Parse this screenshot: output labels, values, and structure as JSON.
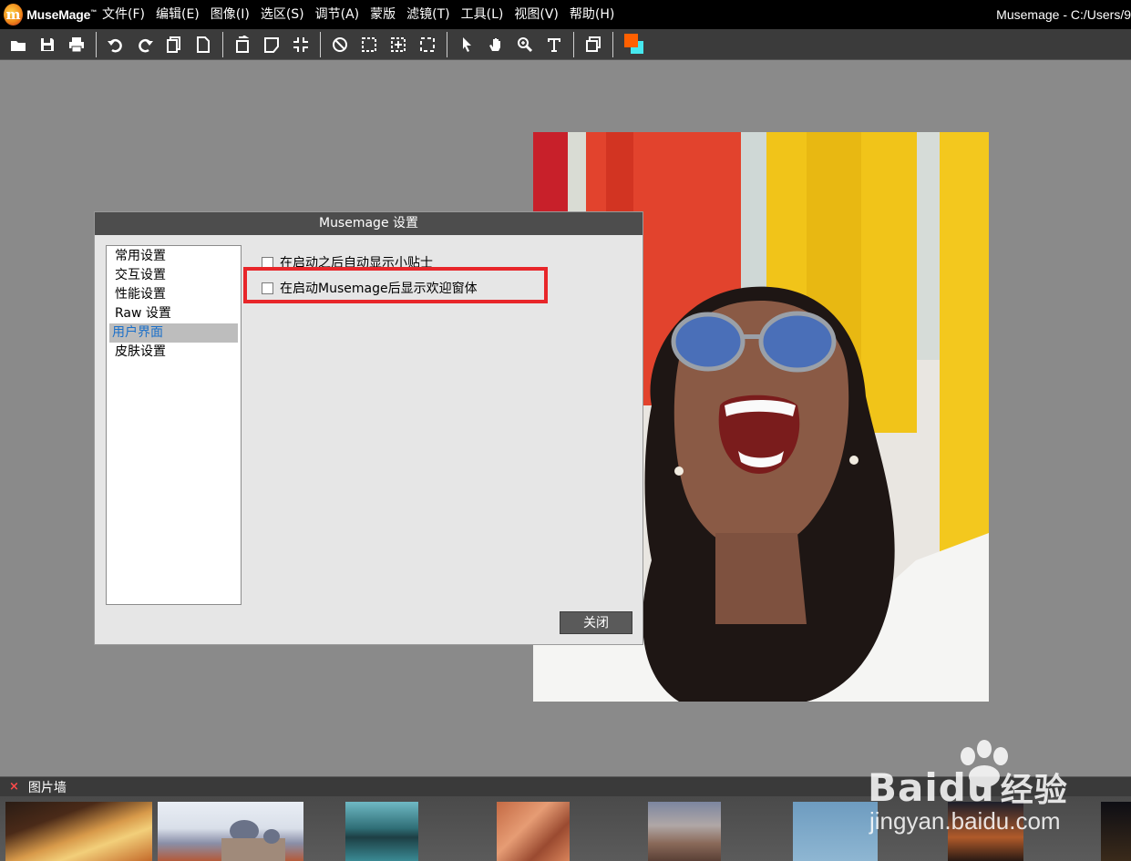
{
  "app": {
    "logo_letter": "m",
    "logo_name": "MuseMage",
    "logo_tm": "™",
    "window_title": "Musemage - C:/Users/9"
  },
  "menu": [
    {
      "label": "文件(F)"
    },
    {
      "label": "编辑(E)"
    },
    {
      "label": "图像(I)"
    },
    {
      "label": "选区(S)"
    },
    {
      "label": "调节(A)"
    },
    {
      "label": "蒙版"
    },
    {
      "label": "滤镜(T)"
    },
    {
      "label": "工具(L)"
    },
    {
      "label": "视图(V)"
    },
    {
      "label": "帮助(H)"
    }
  ],
  "toolbar": {
    "groups": [
      [
        "open-folder-icon",
        "save-icon",
        "print-icon"
      ],
      [
        "undo-icon",
        "redo-icon",
        "copy-icon",
        "new-document-icon"
      ],
      [
        "rotate-icon",
        "flip-icon",
        "fit-screen-icon"
      ],
      [
        "deselect-icon",
        "marquee-select-icon",
        "move-selection-icon",
        "crop-select-icon"
      ],
      [
        "pointer-icon",
        "hand-icon",
        "zoom-icon",
        "text-icon"
      ],
      [
        "layers-icon"
      ]
    ],
    "foreground_color": "#ff6000",
    "background_color": "#46e8ee"
  },
  "dialog": {
    "title": "Musemage 设置",
    "categories": [
      {
        "label": "常用设置",
        "selected": false
      },
      {
        "label": "交互设置",
        "selected": false
      },
      {
        "label": "性能设置",
        "selected": false
      },
      {
        "label": "Raw 设置",
        "selected": false
      },
      {
        "label": "用户界面",
        "selected": true
      },
      {
        "label": "皮肤设置",
        "selected": false
      }
    ],
    "options": [
      {
        "label": "在启动之后自动显示小贴士",
        "checked": false
      },
      {
        "label": "在启动Musemage后显示欢迎窗体",
        "checked": false
      }
    ],
    "highlight_color": "#e8262a",
    "close_label": "关闭"
  },
  "picture_wall": {
    "title": "图片墙",
    "close_glyph": "×"
  },
  "watermark": {
    "brand": "Bai",
    "brand_suffix": "du",
    "brand_cn": "经验",
    "url": "jingyan.baidu.com"
  }
}
